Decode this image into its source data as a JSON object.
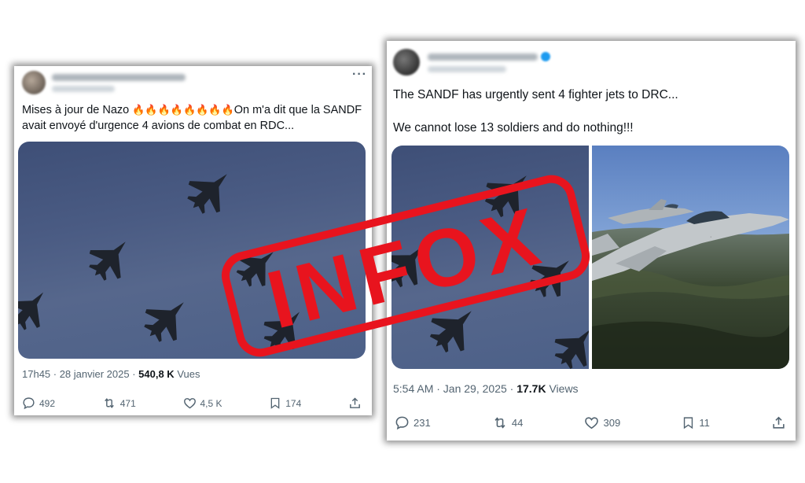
{
  "left_tweet": {
    "text_line1_start": "Mises à jour de Nazo ",
    "fire_emojis": "🔥🔥🔥🔥🔥🔥🔥🔥",
    "text_line1_end": "On m'a dit que la SANDF",
    "text_line2": "avait envoyé d'urgence 4 avions de combat en RDC...",
    "time": "17h45 · 28 janvier 2025 · ",
    "views_count": "540,8 K",
    "views_label": " Vues",
    "replies": "492",
    "reposts": "471",
    "likes": "4,5 K",
    "bookmarks": "174"
  },
  "right_tweet": {
    "text_line1": "The SANDF has urgently sent 4 fighter jets to DRC...",
    "text_line2": "We cannot lose 13 soldiers and do nothing!!!",
    "time": "5:54 AM · Jan 29, 2025 · ",
    "views_count": "17.7K",
    "views_label": " Views",
    "replies": "231",
    "reposts": "44",
    "likes": "309",
    "bookmarks": "11"
  },
  "stamp": {
    "text": "INFOX",
    "color": "#e8141e"
  },
  "icons": [
    "more-icon",
    "reply-icon",
    "repost-icon",
    "like-icon",
    "bookmark-icon",
    "share-icon",
    "verified-icon"
  ],
  "colors": {
    "text": "#0f1419",
    "muted": "#536471",
    "stamp_red": "#e8141e",
    "sky_blue": "#4a5b83"
  }
}
